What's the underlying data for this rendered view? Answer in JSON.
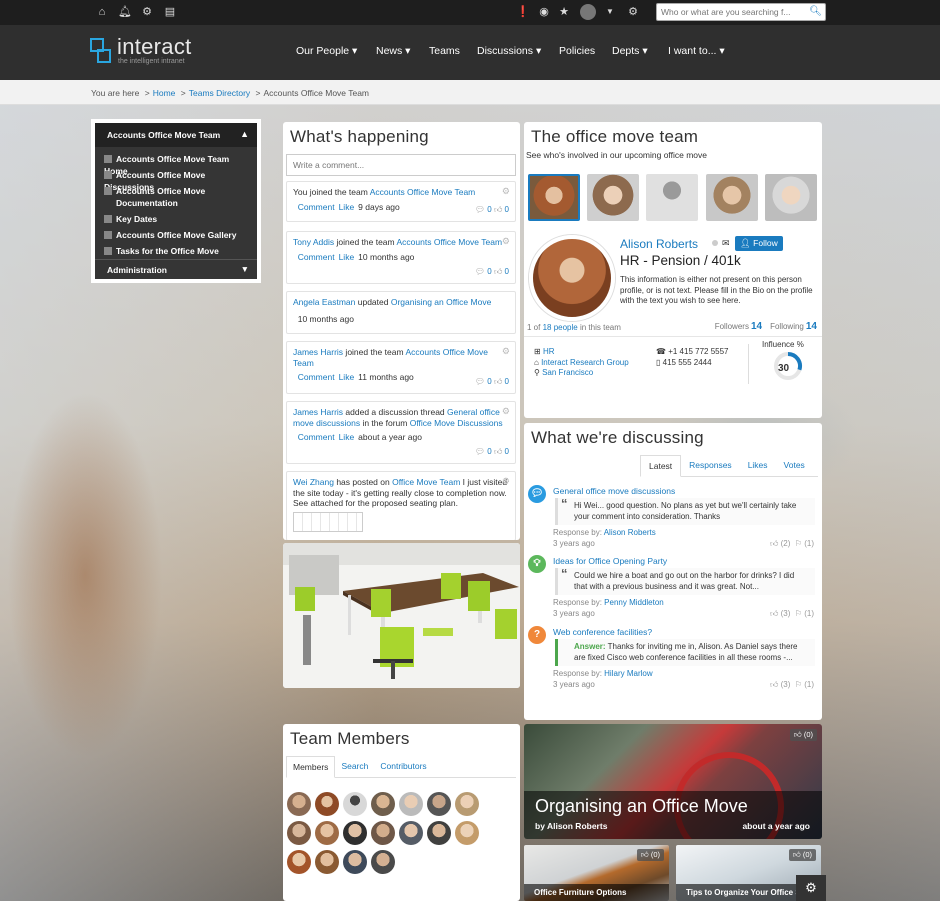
{
  "topbar": {
    "search_placeholder": "Who or what are you searching f..."
  },
  "logo": {
    "word": "interact",
    "tagline": "the intelligent intranet"
  },
  "nav": {
    "items": [
      "Our People",
      "News",
      "Teams",
      "Discussions",
      "Policies",
      "Depts",
      "I want to..."
    ]
  },
  "breadcrumb": {
    "prefix": "You are here",
    "home": "Home",
    "directory": "Teams Directory",
    "current": "Accounts Office Move Team"
  },
  "leftnav": {
    "title": "Accounts Office Move Team",
    "items": [
      "Accounts Office Move Team Home",
      "Accounts Office Move Discussions",
      "Accounts Office Move Documentation",
      "Key Dates",
      "Accounts Office Move Gallery",
      "Tasks for the Office Move"
    ],
    "admin": "Administration"
  },
  "happening": {
    "title": "What's happening",
    "comment_placeholder": "Write a comment...",
    "comment_link": "Comment",
    "like_link": "Like",
    "activities": [
      {
        "actor": "You",
        "text": " joined the team ",
        "target": "Accounts Office Move Team",
        "time": "9 days ago",
        "c1": "0",
        "c2": "0"
      },
      {
        "actor": "Tony Addis",
        "text": " joined the team ",
        "target": "Accounts Office Move Team",
        "time": "10 months ago",
        "c1": "0",
        "c2": "0"
      },
      {
        "actor": "Angela Eastman",
        "text": " updated ",
        "target": "Organising an Office Move",
        "time": "10 months ago"
      },
      {
        "actor": "James Harris",
        "text": " joined the team ",
        "target": "Accounts Office Move Team",
        "time": "11 months ago",
        "c1": "0",
        "c2": "0"
      },
      {
        "actor": "James Harris",
        "text": " added a discussion thread ",
        "target": "General office move discussions",
        "text2": " in the forum ",
        "target2": "Office Move Discussions",
        "time": "about a year ago",
        "c1": "0",
        "c2": "0"
      },
      {
        "actor": "Wei Zhang",
        "text": " has posted on ",
        "target": "Office Move Team",
        "text2": " I just visited the site today - it's getting really close to completion now. See attached for the proposed seating plan."
      }
    ]
  },
  "team": {
    "title": "The office move team",
    "subtitle": "See who's involved in our upcoming office move",
    "person": {
      "name": "Alison Roberts",
      "follow": "Follow",
      "role": "HR - Pension / 401k",
      "bio": "This information is either not present on this person profile, or is not text. Please fill in the Bio on the profile with the text you wish to see here.",
      "position": "1 of",
      "count_link": "18 people",
      "position_suffix": "in this team",
      "followers_label": "Followers",
      "followers": "14",
      "following_label": "Following",
      "following": "14",
      "dept": "HR",
      "company": "Interact Research Group",
      "city": "San Francisco",
      "phone1": "+1 415 772 5557",
      "phone2": "415 555 2444",
      "influence_label": "Influence %",
      "influence": 30
    }
  },
  "discussing": {
    "title": "What we're discussing",
    "tabs": [
      "Latest",
      "Responses",
      "Likes",
      "Votes"
    ],
    "response_by": "Response by:",
    "answer_label": "Answer:",
    "items": [
      {
        "title": "General office move discussions",
        "quote": "Hi Wei... good question. No plans as yet but we'll certainly take your comment into consideration. Thanks",
        "by": "Alison Roberts",
        "time": "3 years ago",
        "likes": "(2)",
        "votes": "(1)",
        "icon": "speech-bubble-icon",
        "color": "#2a9be0"
      },
      {
        "title": "Ideas for Office Opening Party",
        "quote": "Could we hire a boat and go out on the harbor for drinks? I did that with a previous business and it was great. Not...",
        "by": "Penny Middleton",
        "time": "3 years ago",
        "likes": "(3)",
        "votes": "(1)",
        "icon": "lightbulb-icon",
        "color": "#5cb85c"
      },
      {
        "title": "Web conference facilities?",
        "quote": "Thanks for inviting me in, Alison. As Daniel says there are fixed Cisco web conference facilities in all these rooms -...",
        "by": "Hilary Marlow",
        "time": "3 years ago",
        "likes": "(3)",
        "votes": "(1)",
        "icon": "question-icon",
        "color": "#f0883a"
      }
    ]
  },
  "members": {
    "title": "Team Members",
    "tabs": [
      "Members",
      "Search",
      "Contributors"
    ]
  },
  "feature": {
    "title": "Organising an Office Move",
    "author": "by Alison Roberts",
    "date": "about a year ago",
    "likes": "(0)"
  },
  "cards": [
    {
      "title": "Office Furniture Options",
      "likes": "(0)"
    },
    {
      "title": "Tips to Organize Your Office S",
      "likes": "(0)"
    }
  ],
  "colors": {
    "accent": "#1a7bbf",
    "nav_bg": "#2f2f2f",
    "topbar_bg": "#1e1e1e"
  }
}
